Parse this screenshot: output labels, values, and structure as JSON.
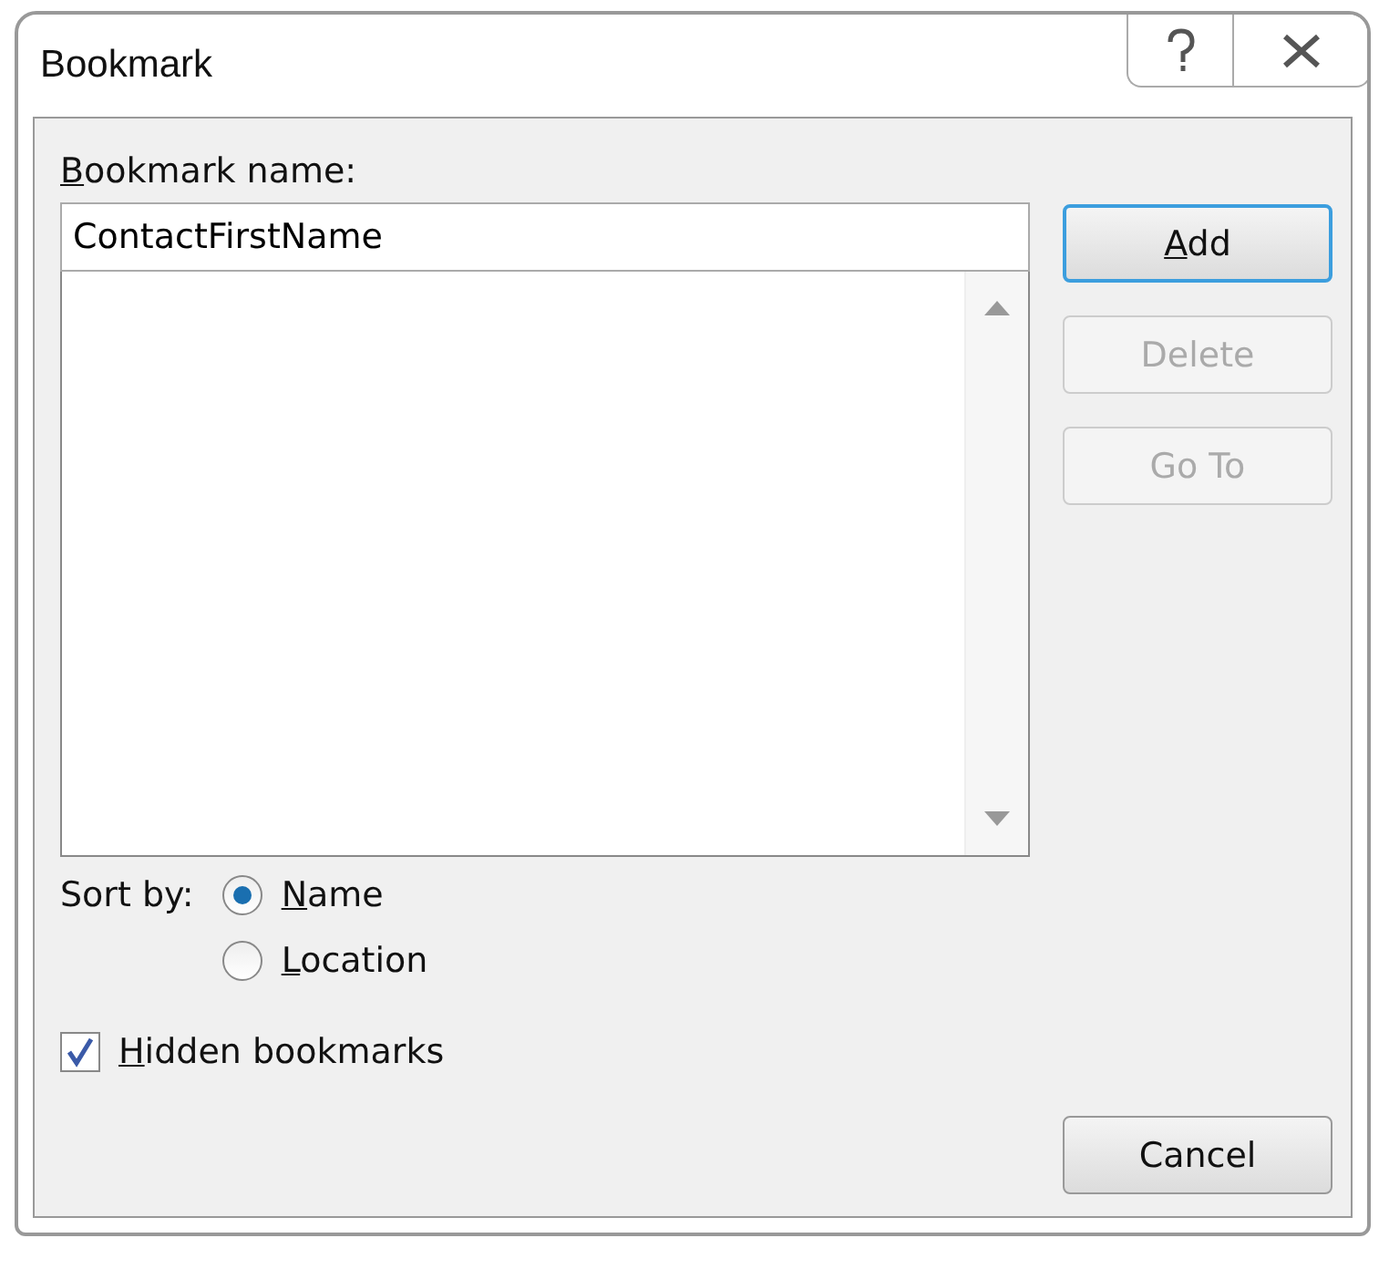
{
  "window": {
    "title": "Bookmark"
  },
  "name_field": {
    "label_key": "B",
    "label_rest": "ookmark name:",
    "value": "ContactFirstName"
  },
  "buttons": [
    {
      "key": "A",
      "rest": "dd",
      "disabled": false,
      "default": true
    },
    {
      "rest": "Delete",
      "disabled": true,
      "default": false
    },
    {
      "rest": "Go To",
      "disabled": true,
      "default": false
    }
  ],
  "sort_by": {
    "label": "Sort by:",
    "options": [
      {
        "key": "N",
        "rest": "ame",
        "selected": true
      },
      {
        "key": "L",
        "rest": "ocation",
        "selected": false
      }
    ]
  },
  "hidden_bookmarks": {
    "key": "H",
    "rest": "idden bookmarks",
    "checked": true
  },
  "cancel_button": {
    "label": "Cancel"
  }
}
